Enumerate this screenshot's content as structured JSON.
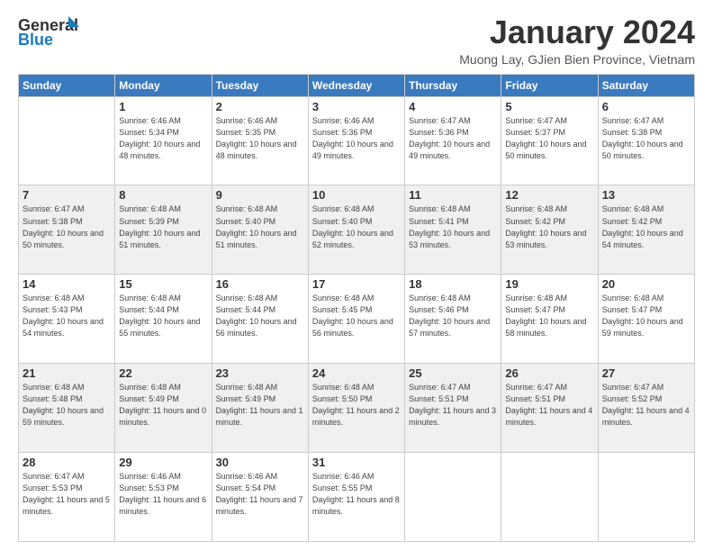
{
  "logo": {
    "line1": "General",
    "line2": "Blue"
  },
  "title": "January 2024",
  "subtitle": "Muong Lay, GJien Bien Province, Vietnam",
  "weekdays": [
    "Sunday",
    "Monday",
    "Tuesday",
    "Wednesday",
    "Thursday",
    "Friday",
    "Saturday"
  ],
  "weeks": [
    [
      {
        "day": "",
        "sunrise": "",
        "sunset": "",
        "daylight": ""
      },
      {
        "day": "1",
        "sunrise": "Sunrise: 6:46 AM",
        "sunset": "Sunset: 5:34 PM",
        "daylight": "Daylight: 10 hours and 48 minutes."
      },
      {
        "day": "2",
        "sunrise": "Sunrise: 6:46 AM",
        "sunset": "Sunset: 5:35 PM",
        "daylight": "Daylight: 10 hours and 48 minutes."
      },
      {
        "day": "3",
        "sunrise": "Sunrise: 6:46 AM",
        "sunset": "Sunset: 5:36 PM",
        "daylight": "Daylight: 10 hours and 49 minutes."
      },
      {
        "day": "4",
        "sunrise": "Sunrise: 6:47 AM",
        "sunset": "Sunset: 5:36 PM",
        "daylight": "Daylight: 10 hours and 49 minutes."
      },
      {
        "day": "5",
        "sunrise": "Sunrise: 6:47 AM",
        "sunset": "Sunset: 5:37 PM",
        "daylight": "Daylight: 10 hours and 50 minutes."
      },
      {
        "day": "6",
        "sunrise": "Sunrise: 6:47 AM",
        "sunset": "Sunset: 5:38 PM",
        "daylight": "Daylight: 10 hours and 50 minutes."
      }
    ],
    [
      {
        "day": "7",
        "sunrise": "Sunrise: 6:47 AM",
        "sunset": "Sunset: 5:38 PM",
        "daylight": "Daylight: 10 hours and 50 minutes."
      },
      {
        "day": "8",
        "sunrise": "Sunrise: 6:48 AM",
        "sunset": "Sunset: 5:39 PM",
        "daylight": "Daylight: 10 hours and 51 minutes."
      },
      {
        "day": "9",
        "sunrise": "Sunrise: 6:48 AM",
        "sunset": "Sunset: 5:40 PM",
        "daylight": "Daylight: 10 hours and 51 minutes."
      },
      {
        "day": "10",
        "sunrise": "Sunrise: 6:48 AM",
        "sunset": "Sunset: 5:40 PM",
        "daylight": "Daylight: 10 hours and 52 minutes."
      },
      {
        "day": "11",
        "sunrise": "Sunrise: 6:48 AM",
        "sunset": "Sunset: 5:41 PM",
        "daylight": "Daylight: 10 hours and 53 minutes."
      },
      {
        "day": "12",
        "sunrise": "Sunrise: 6:48 AM",
        "sunset": "Sunset: 5:42 PM",
        "daylight": "Daylight: 10 hours and 53 minutes."
      },
      {
        "day": "13",
        "sunrise": "Sunrise: 6:48 AM",
        "sunset": "Sunset: 5:42 PM",
        "daylight": "Daylight: 10 hours and 54 minutes."
      }
    ],
    [
      {
        "day": "14",
        "sunrise": "Sunrise: 6:48 AM",
        "sunset": "Sunset: 5:43 PM",
        "daylight": "Daylight: 10 hours and 54 minutes."
      },
      {
        "day": "15",
        "sunrise": "Sunrise: 6:48 AM",
        "sunset": "Sunset: 5:44 PM",
        "daylight": "Daylight: 10 hours and 55 minutes."
      },
      {
        "day": "16",
        "sunrise": "Sunrise: 6:48 AM",
        "sunset": "Sunset: 5:44 PM",
        "daylight": "Daylight: 10 hours and 56 minutes."
      },
      {
        "day": "17",
        "sunrise": "Sunrise: 6:48 AM",
        "sunset": "Sunset: 5:45 PM",
        "daylight": "Daylight: 10 hours and 56 minutes."
      },
      {
        "day": "18",
        "sunrise": "Sunrise: 6:48 AM",
        "sunset": "Sunset: 5:46 PM",
        "daylight": "Daylight: 10 hours and 57 minutes."
      },
      {
        "day": "19",
        "sunrise": "Sunrise: 6:48 AM",
        "sunset": "Sunset: 5:47 PM",
        "daylight": "Daylight: 10 hours and 58 minutes."
      },
      {
        "day": "20",
        "sunrise": "Sunrise: 6:48 AM",
        "sunset": "Sunset: 5:47 PM",
        "daylight": "Daylight: 10 hours and 59 minutes."
      }
    ],
    [
      {
        "day": "21",
        "sunrise": "Sunrise: 6:48 AM",
        "sunset": "Sunset: 5:48 PM",
        "daylight": "Daylight: 10 hours and 59 minutes."
      },
      {
        "day": "22",
        "sunrise": "Sunrise: 6:48 AM",
        "sunset": "Sunset: 5:49 PM",
        "daylight": "Daylight: 11 hours and 0 minutes."
      },
      {
        "day": "23",
        "sunrise": "Sunrise: 6:48 AM",
        "sunset": "Sunset: 5:49 PM",
        "daylight": "Daylight: 11 hours and 1 minute."
      },
      {
        "day": "24",
        "sunrise": "Sunrise: 6:48 AM",
        "sunset": "Sunset: 5:50 PM",
        "daylight": "Daylight: 11 hours and 2 minutes."
      },
      {
        "day": "25",
        "sunrise": "Sunrise: 6:47 AM",
        "sunset": "Sunset: 5:51 PM",
        "daylight": "Daylight: 11 hours and 3 minutes."
      },
      {
        "day": "26",
        "sunrise": "Sunrise: 6:47 AM",
        "sunset": "Sunset: 5:51 PM",
        "daylight": "Daylight: 11 hours and 4 minutes."
      },
      {
        "day": "27",
        "sunrise": "Sunrise: 6:47 AM",
        "sunset": "Sunset: 5:52 PM",
        "daylight": "Daylight: 11 hours and 4 minutes."
      }
    ],
    [
      {
        "day": "28",
        "sunrise": "Sunrise: 6:47 AM",
        "sunset": "Sunset: 5:53 PM",
        "daylight": "Daylight: 11 hours and 5 minutes."
      },
      {
        "day": "29",
        "sunrise": "Sunrise: 6:46 AM",
        "sunset": "Sunset: 5:53 PM",
        "daylight": "Daylight: 11 hours and 6 minutes."
      },
      {
        "day": "30",
        "sunrise": "Sunrise: 6:46 AM",
        "sunset": "Sunset: 5:54 PM",
        "daylight": "Daylight: 11 hours and 7 minutes."
      },
      {
        "day": "31",
        "sunrise": "Sunrise: 6:46 AM",
        "sunset": "Sunset: 5:55 PM",
        "daylight": "Daylight: 11 hours and 8 minutes."
      },
      {
        "day": "",
        "sunrise": "",
        "sunset": "",
        "daylight": ""
      },
      {
        "day": "",
        "sunrise": "",
        "sunset": "",
        "daylight": ""
      },
      {
        "day": "",
        "sunrise": "",
        "sunset": "",
        "daylight": ""
      }
    ]
  ]
}
